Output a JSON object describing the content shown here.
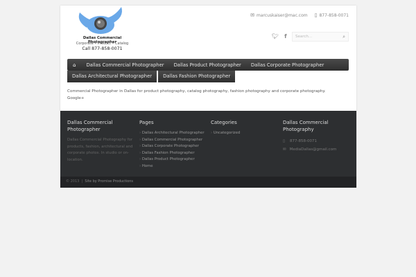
{
  "logo": {
    "title": "Dallas Commercial Photographer",
    "tagline": "Corporate • Product • Catalog",
    "phone": "Call 877-858-0071"
  },
  "header": {
    "email": "marcuskaiser@mac.com",
    "phone": "877-858-0071",
    "search_placeholder": "Search..."
  },
  "nav": {
    "items": [
      "Dallas Commercial Photographer",
      "Dallas Product Photographer",
      "Dallas Corporate Photographer"
    ],
    "items2": [
      "Dallas Architectural Photographer",
      "Dallas Fashion Photographer"
    ]
  },
  "intro": {
    "text": "Commercial Photographer in Dallas for product photography, catalog photography, fashion photography and corporate photography.",
    "link": "Google+"
  },
  "footer": {
    "about": {
      "title": "Dallas Commercial Photographer",
      "text": "Dallas Commercial Photography for products, fashion, architectural and corporate photos. In studio or on-location."
    },
    "pages": {
      "title": "Pages",
      "items": [
        "Dallas Architectural Photographer",
        "Dallas Commercial Photographer",
        "Dallas Corporate Photographer",
        "Dallas Fashion Photographer",
        "Dallas Product Photographer",
        "Home"
      ]
    },
    "categories": {
      "title": "Categories",
      "items": [
        "Uncategorized"
      ]
    },
    "contact": {
      "title": "Dallas Commercial Photography",
      "phone": "877-858-0071",
      "email": "MediaDallas@gmail.com"
    },
    "copyright": "© 2013",
    "sep": "|",
    "credit": "Site by Promise Productions"
  }
}
